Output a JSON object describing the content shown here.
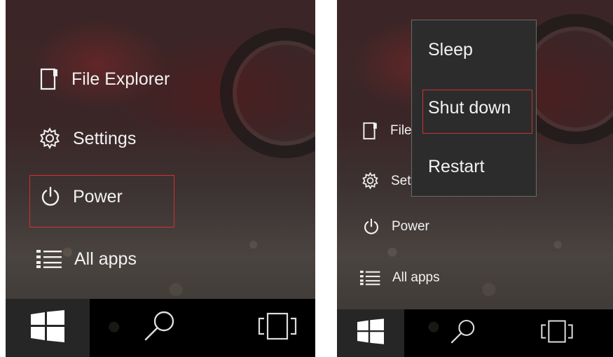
{
  "left_panel": {
    "items": [
      {
        "label": "File Explorer",
        "icon": "file-explorer-icon"
      },
      {
        "label": "Settings",
        "icon": "gear-icon"
      },
      {
        "label": "Power",
        "icon": "power-icon"
      },
      {
        "label": "All apps",
        "icon": "list-icon"
      }
    ],
    "taskbar": [
      "windows-logo-icon",
      "search-icon",
      "task-view-icon"
    ]
  },
  "right_panel": {
    "items": [
      {
        "label": "File Explorer",
        "icon": "file-explorer-icon"
      },
      {
        "label": "Settings",
        "icon": "gear-icon"
      },
      {
        "label": "Power",
        "icon": "power-icon"
      },
      {
        "label": "All apps",
        "icon": "list-icon"
      }
    ],
    "power_menu": {
      "items": [
        {
          "label": "Sleep"
        },
        {
          "label": "Shut down"
        },
        {
          "label": "Restart"
        }
      ]
    },
    "taskbar": [
      "windows-logo-icon",
      "search-icon",
      "task-view-icon"
    ]
  },
  "colors": {
    "highlight": "#d23030",
    "taskbar": "#000000",
    "menu_background": "#2c2c2c",
    "text": "#f2f2f2"
  }
}
